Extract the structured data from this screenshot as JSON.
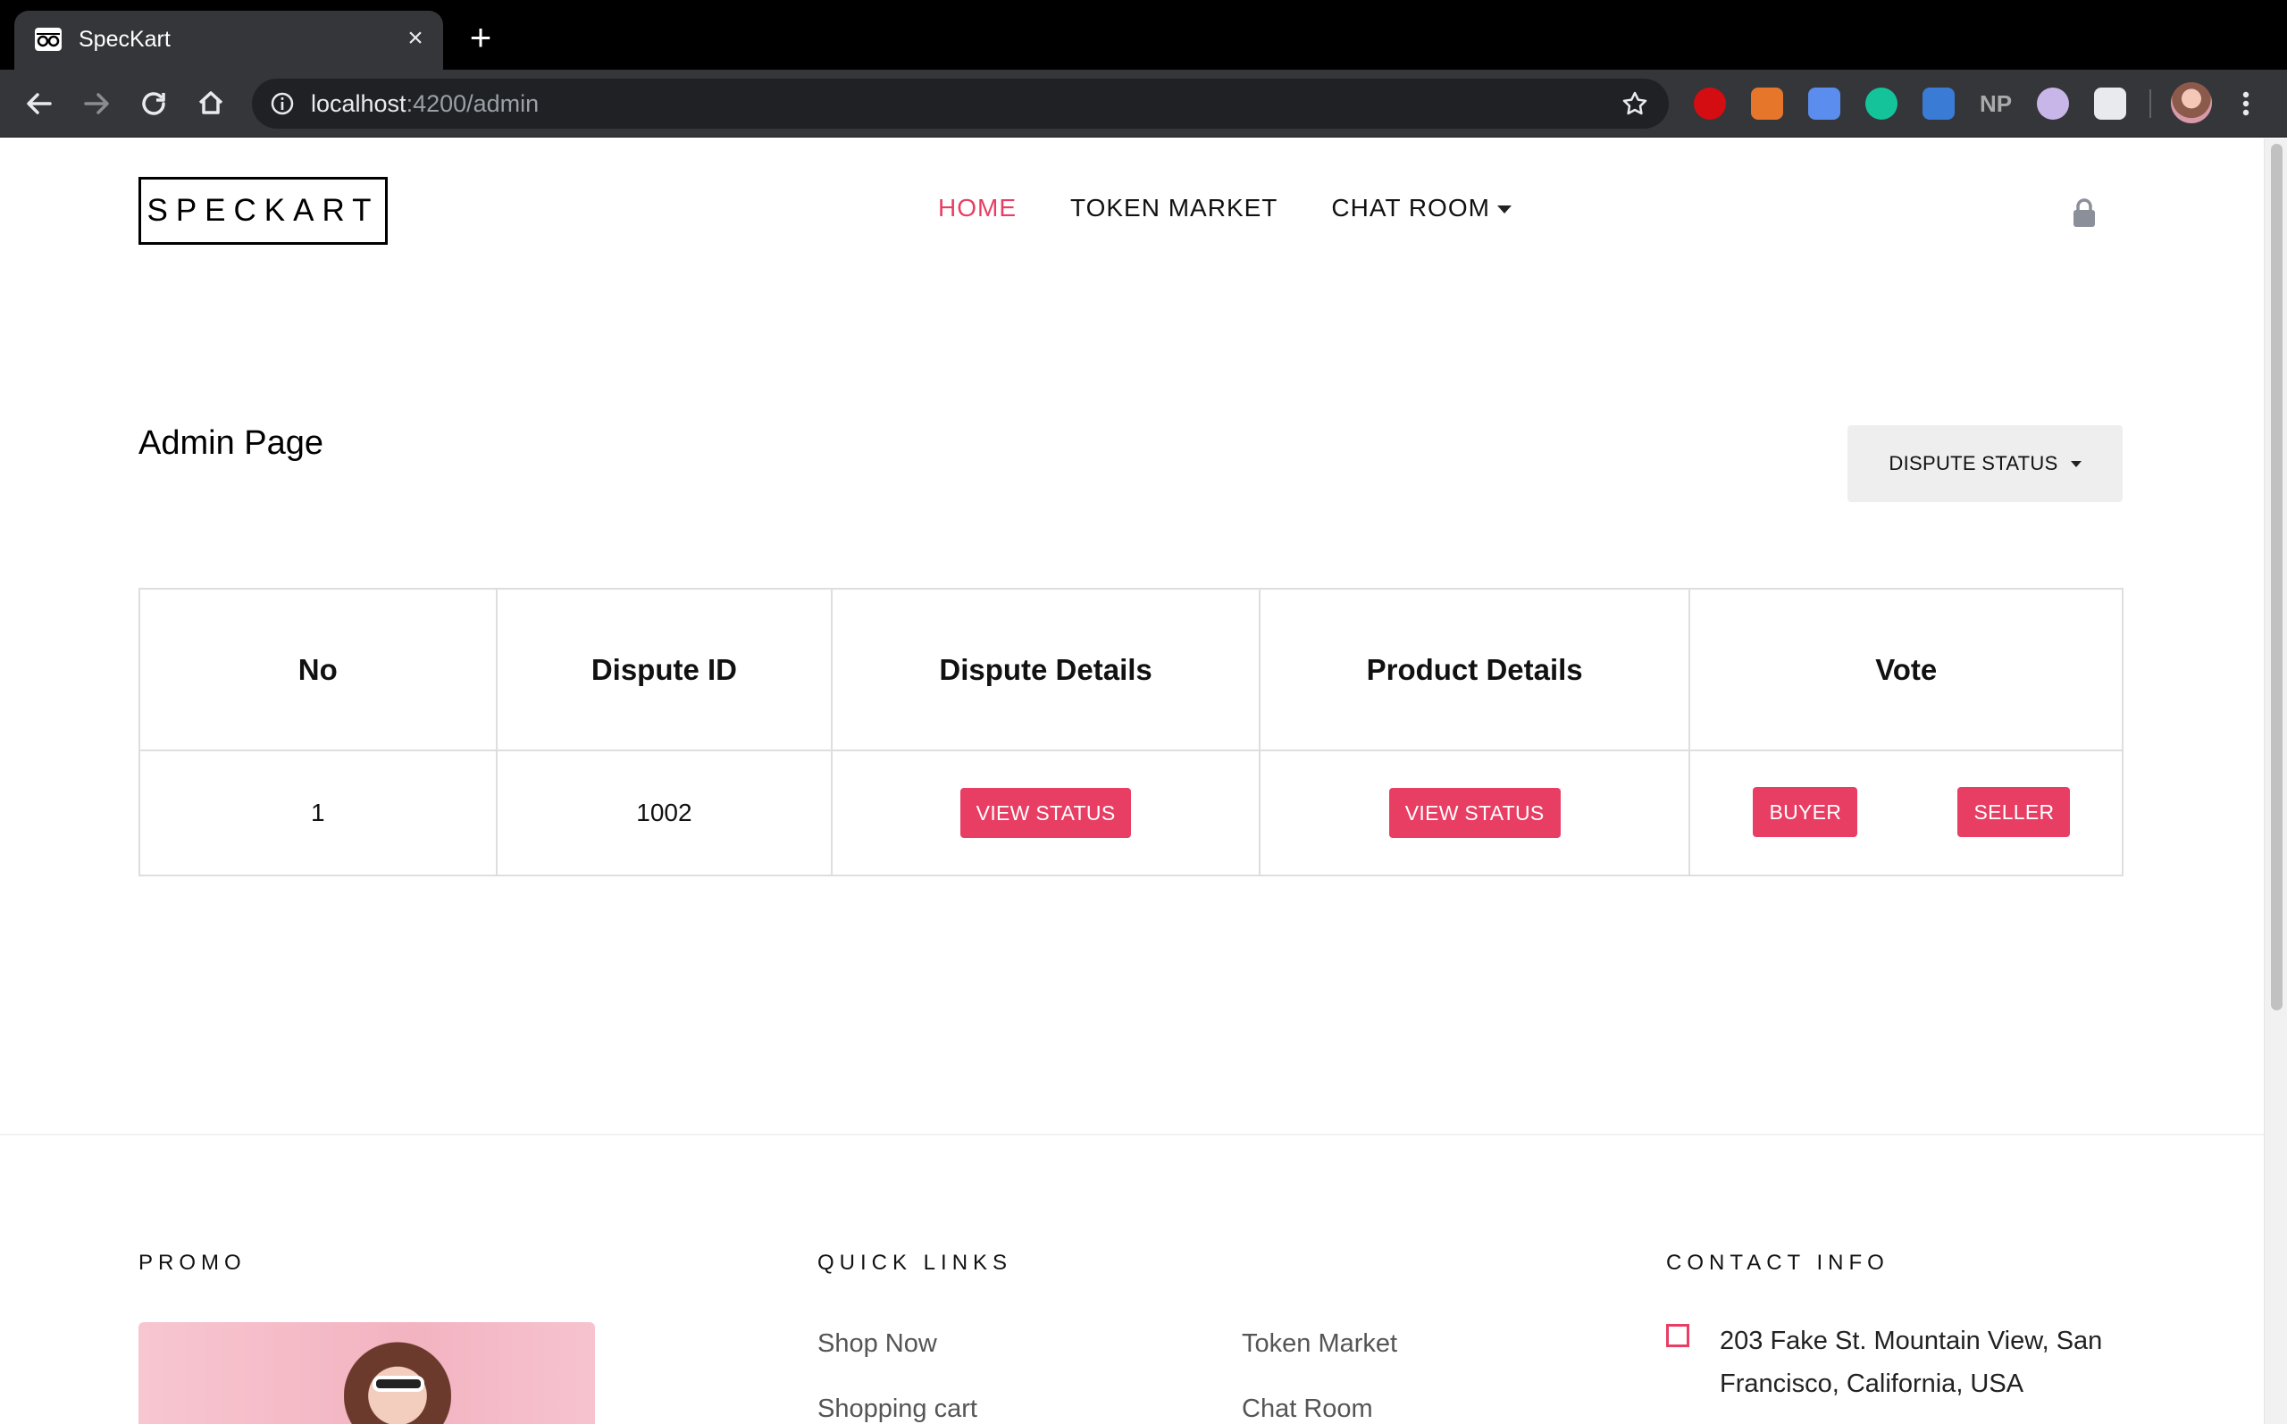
{
  "browser": {
    "tab_title": "SpecKart",
    "tab_close": "×",
    "new_tab": "+",
    "url_host": "localhost",
    "url_rest": ":4200/admin",
    "extensions": [
      "ublock-icon",
      "metamask-icon",
      "camera-icon",
      "grammarly-icon",
      "extension-plus-icon",
      "np-icon",
      "play-icon",
      "screenshot-icon"
    ]
  },
  "header": {
    "logo": "SPECKART",
    "nav": [
      {
        "label": "HOME",
        "active": true
      },
      {
        "label": "TOKEN MARKET",
        "active": false
      },
      {
        "label": "CHAT ROOM",
        "active": false
      }
    ]
  },
  "main": {
    "title": "Admin Page",
    "dispute_button": "DISPUTE STATUS",
    "table": {
      "headers": [
        "No",
        "Dispute ID",
        "Dispute Details",
        "Product Details",
        "Vote"
      ],
      "rows": [
        {
          "no": "1",
          "dispute_id": "1002",
          "dispute_details_btn": "VIEW STATUS",
          "product_details_btn": "VIEW STATUS",
          "vote_buyer": "BUYER",
          "vote_seller": "SELLER"
        }
      ]
    }
  },
  "footer": {
    "promo_heading": "PROMO",
    "quick_links_heading": "QUICK LINKS",
    "contact_heading": "CONTACT INFO",
    "quick_links": [
      "Shop Now",
      "Token Market",
      "Shopping cart",
      "Chat Room"
    ],
    "address": "203 Fake St. Mountain View, San Francisco, California, USA"
  },
  "colors": {
    "accent": "#e83e64",
    "chrome_dark": "#35363a"
  }
}
